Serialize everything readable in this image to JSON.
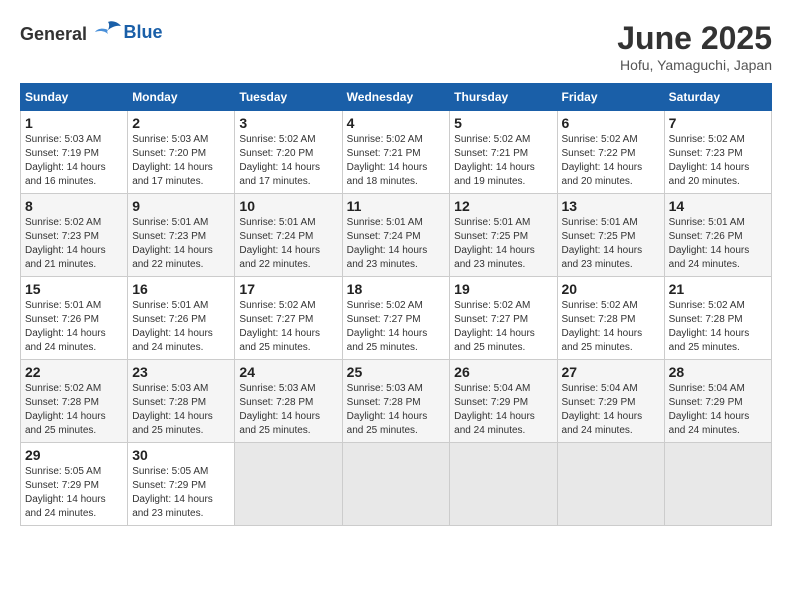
{
  "header": {
    "logo_general": "General",
    "logo_blue": "Blue",
    "title": "June 2025",
    "subtitle": "Hofu, Yamaguchi, Japan"
  },
  "calendar": {
    "weekdays": [
      "Sunday",
      "Monday",
      "Tuesday",
      "Wednesday",
      "Thursday",
      "Friday",
      "Saturday"
    ],
    "weeks": [
      [
        null,
        null,
        null,
        null,
        null,
        null,
        null
      ]
    ],
    "days": {
      "1": {
        "sunrise": "5:03 AM",
        "sunset": "7:19 PM",
        "daylight": "14 hours and 16 minutes."
      },
      "2": {
        "sunrise": "5:03 AM",
        "sunset": "7:20 PM",
        "daylight": "14 hours and 17 minutes."
      },
      "3": {
        "sunrise": "5:02 AM",
        "sunset": "7:20 PM",
        "daylight": "14 hours and 17 minutes."
      },
      "4": {
        "sunrise": "5:02 AM",
        "sunset": "7:21 PM",
        "daylight": "14 hours and 18 minutes."
      },
      "5": {
        "sunrise": "5:02 AM",
        "sunset": "7:21 PM",
        "daylight": "14 hours and 19 minutes."
      },
      "6": {
        "sunrise": "5:02 AM",
        "sunset": "7:22 PM",
        "daylight": "14 hours and 20 minutes."
      },
      "7": {
        "sunrise": "5:02 AM",
        "sunset": "7:23 PM",
        "daylight": "14 hours and 20 minutes."
      },
      "8": {
        "sunrise": "5:02 AM",
        "sunset": "7:23 PM",
        "daylight": "14 hours and 21 minutes."
      },
      "9": {
        "sunrise": "5:01 AM",
        "sunset": "7:23 PM",
        "daylight": "14 hours and 22 minutes."
      },
      "10": {
        "sunrise": "5:01 AM",
        "sunset": "7:24 PM",
        "daylight": "14 hours and 22 minutes."
      },
      "11": {
        "sunrise": "5:01 AM",
        "sunset": "7:24 PM",
        "daylight": "14 hours and 23 minutes."
      },
      "12": {
        "sunrise": "5:01 AM",
        "sunset": "7:25 PM",
        "daylight": "14 hours and 23 minutes."
      },
      "13": {
        "sunrise": "5:01 AM",
        "sunset": "7:25 PM",
        "daylight": "14 hours and 23 minutes."
      },
      "14": {
        "sunrise": "5:01 AM",
        "sunset": "7:26 PM",
        "daylight": "14 hours and 24 minutes."
      },
      "15": {
        "sunrise": "5:01 AM",
        "sunset": "7:26 PM",
        "daylight": "14 hours and 24 minutes."
      },
      "16": {
        "sunrise": "5:01 AM",
        "sunset": "7:26 PM",
        "daylight": "14 hours and 24 minutes."
      },
      "17": {
        "sunrise": "5:02 AM",
        "sunset": "7:27 PM",
        "daylight": "14 hours and 25 minutes."
      },
      "18": {
        "sunrise": "5:02 AM",
        "sunset": "7:27 PM",
        "daylight": "14 hours and 25 minutes."
      },
      "19": {
        "sunrise": "5:02 AM",
        "sunset": "7:27 PM",
        "daylight": "14 hours and 25 minutes."
      },
      "20": {
        "sunrise": "5:02 AM",
        "sunset": "7:28 PM",
        "daylight": "14 hours and 25 minutes."
      },
      "21": {
        "sunrise": "5:02 AM",
        "sunset": "7:28 PM",
        "daylight": "14 hours and 25 minutes."
      },
      "22": {
        "sunrise": "5:02 AM",
        "sunset": "7:28 PM",
        "daylight": "14 hours and 25 minutes."
      },
      "23": {
        "sunrise": "5:03 AM",
        "sunset": "7:28 PM",
        "daylight": "14 hours and 25 minutes."
      },
      "24": {
        "sunrise": "5:03 AM",
        "sunset": "7:28 PM",
        "daylight": "14 hours and 25 minutes."
      },
      "25": {
        "sunrise": "5:03 AM",
        "sunset": "7:28 PM",
        "daylight": "14 hours and 25 minutes."
      },
      "26": {
        "sunrise": "5:04 AM",
        "sunset": "7:29 PM",
        "daylight": "14 hours and 24 minutes."
      },
      "27": {
        "sunrise": "5:04 AM",
        "sunset": "7:29 PM",
        "daylight": "14 hours and 24 minutes."
      },
      "28": {
        "sunrise": "5:04 AM",
        "sunset": "7:29 PM",
        "daylight": "14 hours and 24 minutes."
      },
      "29": {
        "sunrise": "5:05 AM",
        "sunset": "7:29 PM",
        "daylight": "14 hours and 24 minutes."
      },
      "30": {
        "sunrise": "5:05 AM",
        "sunset": "7:29 PM",
        "daylight": "14 hours and 23 minutes."
      }
    }
  }
}
